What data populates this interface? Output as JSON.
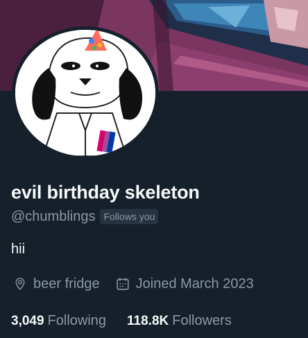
{
  "profile": {
    "display_name": "evil birthday skeleton",
    "handle": "@chumblings",
    "follows_you_badge": "Follows you",
    "bio": "hii",
    "location": "beer fridge",
    "joined": "Joined March 2023",
    "location_icon": "location-pin-icon",
    "joined_icon": "calendar-icon"
  },
  "stats": {
    "following_count": "3,049",
    "following_label": "Following",
    "followers_count": "118.8K",
    "followers_label": "Followers"
  },
  "colors": {
    "background": "#15202b",
    "primary_text": "#f7f9f9",
    "secondary_text": "#8b98a5",
    "badge_bg": "#273340"
  }
}
